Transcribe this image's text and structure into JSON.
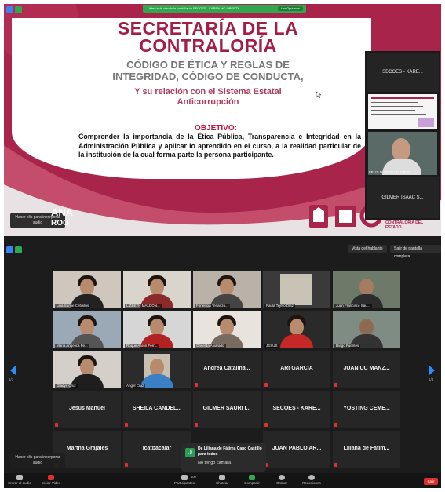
{
  "share_bar": {
    "message": "Usted está viendo la pantalla de SECOES - KAREN MC LIBERTY",
    "options_label": "Ver Opciones"
  },
  "slide": {
    "title_line1": "SECRETARÍA DE LA",
    "title_line2": "CONTRALORÍA",
    "subtitle_line1": "CÓDIGO DE ÉTICA Y REGLAS DE",
    "subtitle_line2": "INTEGRIDAD, CÓDIGO DE CONDUCTA,",
    "relation_line1": "Y su relación con el Sistema Estatal",
    "relation_line2": "Anticorrupción",
    "objective_label": "OBJETIVO:",
    "objective_text": "Comprender la importancia de la Ética Pública, Transparencia e Integridad en la Administración Pública y aplicar lo aprendido en el curso, a la realidad particular de la institución de la cual forma parte la persona participante.",
    "logo_left_text": "ANA",
    "logo_left_text2": "ROO",
    "logo_right_text": "SECRETARÍA DE LA CONTRALORÍA DEL ESTADO"
  },
  "audio_tip": "Hacer clic para incorporar audio",
  "side_panel": {
    "top_tile": "SECOES - KARE...",
    "person_caption": "FELIX DIAZ VILLALOBOS",
    "bottom_tile": "GILMER ISAAC S..."
  },
  "gallery_bar": {
    "speaker_view": "Vista del hablante",
    "exit_fullscreen": "Salir de pantalla completa"
  },
  "page_left": "1/3",
  "page_right": "1/3",
  "tiles": [
    {
      "caption": "Lina Sumie Ceballos"
    },
    {
      "caption": "LIZBETH MALDON..."
    },
    {
      "caption": "Fortencia Tenanzo..."
    },
    {
      "caption": "Paula Tejeto Diaz"
    },
    {
      "caption": "Juan Francisco Sau..."
    },
    {
      "caption": "Maria Angelica Fe..."
    },
    {
      "caption": "Roque Aaron Ferr..."
    },
    {
      "caption": "Griselda Alvarado"
    },
    {
      "caption": "JESUS"
    },
    {
      "caption": "Diego Fuentes"
    },
    {
      "caption": "Gladys Cruz"
    },
    {
      "caption": "Angel Cruz"
    },
    {
      "name": "Andrea  Catalina..."
    },
    {
      "name": "ARI GARCÍA"
    },
    {
      "name": "JUAN UC MANZ..."
    },
    {
      "name": "Jesus Manuel"
    },
    {
      "name": "SHEILA  CANDEL..."
    },
    {
      "name": "GILMER SAURI I..."
    },
    {
      "name": "SECOES - KARE..."
    },
    {
      "name": "YOSTING  CEME..."
    },
    {
      "name": "Martha Grajales"
    },
    {
      "name": "icatbacalar"
    },
    {
      "name": "JUAN PABLO AR..."
    },
    {
      "name": "Liliana  de  Fátim..."
    }
  ],
  "chat_popup": {
    "avatar": "LD",
    "from": "De Liliana de Fátima Cano Castillo para todos",
    "message": "No tengo camara"
  },
  "toolbar": {
    "audio": "Entrar al audio",
    "video": "Iniciar Video",
    "participants": "Participantes",
    "participants_count": "100",
    "chat": "Chatear",
    "share": "Compartir",
    "record": "Grabar",
    "reactions": "Reacciones",
    "end": "Salir"
  },
  "colors": {
    "brand": "#a8244b",
    "share_green": "#2fa84f",
    "end_red": "#d9302f"
  }
}
